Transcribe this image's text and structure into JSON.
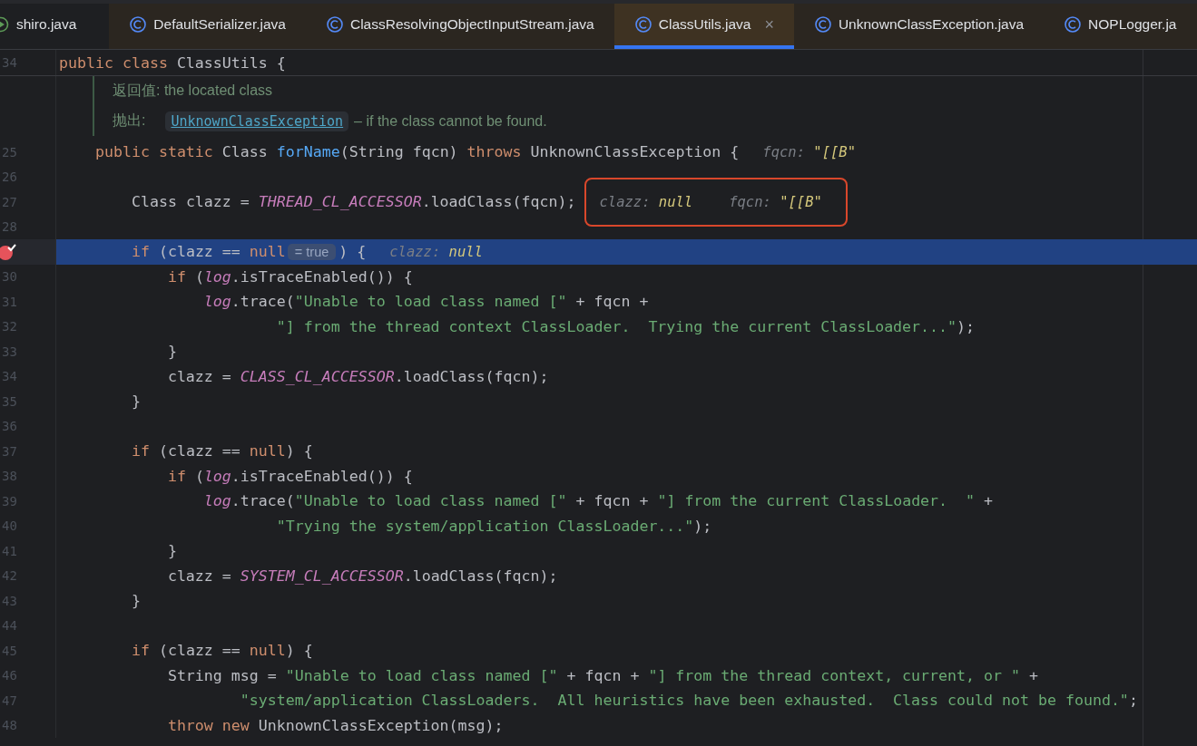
{
  "tabs": [
    {
      "label": "shiro.java",
      "selected": false
    },
    {
      "label": "DefaultSerializer.java",
      "selected": false
    },
    {
      "label": "ClassResolvingObjectInputStream.java",
      "selected": false
    },
    {
      "label": "ClassUtils.java",
      "selected": true,
      "close": "×"
    },
    {
      "label": "UnknownClassException.java",
      "selected": false
    },
    {
      "label": "NOPLogger.ja",
      "selected": false
    }
  ],
  "sticky_line": {
    "number": "34",
    "tokens": [
      {
        "kind": "keyword",
        "text": "public class "
      },
      {
        "kind": "plain",
        "text": "ClassUtils {"
      }
    ]
  },
  "doc": {
    "returns": "返回值: the located class",
    "throws_label": "抛出:",
    "throws_link": "UnknownClassException",
    "throws_text": "– if the class cannot be found."
  },
  "lines": [
    {
      "number": "25",
      "highlighted": false,
      "breakpoint": false,
      "tokens": [
        {
          "kind": "keyword",
          "text": "    public static "
        },
        {
          "kind": "plain",
          "text": "Class "
        },
        {
          "kind": "method",
          "text": "forName"
        },
        {
          "kind": "plain",
          "text": "(String fqcn) "
        },
        {
          "kind": "keyword",
          "text": "throws "
        },
        {
          "kind": "plain",
          "text": "UnknownClassException {"
        }
      ],
      "hints": [
        {
          "label": "fqcn:",
          "value": "\"[[B\""
        }
      ],
      "hints_framed": false
    },
    {
      "number": "26",
      "highlighted": false,
      "breakpoint": false
    },
    {
      "number": "27",
      "highlighted": false,
      "breakpoint": false,
      "tokens": [
        {
          "kind": "plain",
          "text": "        Class clazz = "
        },
        {
          "kind": "constant",
          "text": "THREAD_CL_ACCESSOR"
        },
        {
          "kind": "plain",
          "text": ".loadClass(fqcn);"
        }
      ],
      "hints": [
        {
          "label": "clazz:",
          "value": "null"
        },
        {
          "label": "fqcn:",
          "value": "\"[[B\""
        }
      ],
      "hints_framed": true
    },
    {
      "number": "28",
      "highlighted": false,
      "breakpoint": false
    },
    {
      "highlighted": true,
      "breakpoint": true,
      "tokens": [
        {
          "kind": "keyword",
          "text": "        if "
        },
        {
          "kind": "plain",
          "text": "(clazz == "
        },
        {
          "kind": "keyword",
          "text": "null"
        },
        {
          "kind": "eval",
          "text": "= true"
        },
        {
          "kind": "plain",
          "text": ") {"
        }
      ],
      "hints": [
        {
          "label": "clazz:",
          "value": "null"
        }
      ],
      "hints_framed": false
    },
    {
      "number": "30",
      "highlighted": false,
      "breakpoint": false,
      "tokens": [
        {
          "kind": "keyword",
          "text": "            if "
        },
        {
          "kind": "plain",
          "text": "("
        },
        {
          "kind": "field",
          "text": "log"
        },
        {
          "kind": "plain",
          "text": ".isTraceEnabled()) {"
        }
      ]
    },
    {
      "number": "31",
      "highlighted": false,
      "breakpoint": false,
      "tokens": [
        {
          "kind": "field",
          "text": "                log"
        },
        {
          "kind": "plain",
          "text": ".trace("
        },
        {
          "kind": "string",
          "text": "\"Unable to load class named [\""
        },
        {
          "kind": "plain",
          "text": " + fqcn +"
        }
      ]
    },
    {
      "number": "32",
      "highlighted": false,
      "breakpoint": false,
      "tokens": [
        {
          "kind": "string",
          "text": "                        \"] from the thread context ClassLoader.  Trying the current ClassLoader...\""
        },
        {
          "kind": "plain",
          "text": ");"
        }
      ]
    },
    {
      "number": "33",
      "highlighted": false,
      "breakpoint": false,
      "tokens": [
        {
          "kind": "plain",
          "text": "            }"
        }
      ]
    },
    {
      "number": "34",
      "highlighted": false,
      "breakpoint": false,
      "tokens": [
        {
          "kind": "plain",
          "text": "            clazz = "
        },
        {
          "kind": "constant",
          "text": "CLASS_CL_ACCESSOR"
        },
        {
          "kind": "plain",
          "text": ".loadClass(fqcn);"
        }
      ]
    },
    {
      "number": "35",
      "highlighted": false,
      "breakpoint": false,
      "tokens": [
        {
          "kind": "plain",
          "text": "        }"
        }
      ]
    },
    {
      "number": "36",
      "highlighted": false,
      "breakpoint": false
    },
    {
      "number": "37",
      "highlighted": false,
      "breakpoint": false,
      "tokens": [
        {
          "kind": "keyword",
          "text": "        if "
        },
        {
          "kind": "plain",
          "text": "(clazz == "
        },
        {
          "kind": "keyword",
          "text": "null"
        },
        {
          "kind": "plain",
          "text": ") {"
        }
      ]
    },
    {
      "number": "38",
      "highlighted": false,
      "breakpoint": false,
      "tokens": [
        {
          "kind": "keyword",
          "text": "            if "
        },
        {
          "kind": "plain",
          "text": "("
        },
        {
          "kind": "field",
          "text": "log"
        },
        {
          "kind": "plain",
          "text": ".isTraceEnabled()) {"
        }
      ]
    },
    {
      "number": "39",
      "highlighted": false,
      "breakpoint": false,
      "tokens": [
        {
          "kind": "field",
          "text": "                log"
        },
        {
          "kind": "plain",
          "text": ".trace("
        },
        {
          "kind": "string",
          "text": "\"Unable to load class named [\""
        },
        {
          "kind": "plain",
          "text": " + fqcn + "
        },
        {
          "kind": "string",
          "text": "\"] from the current ClassLoader.  \""
        },
        {
          "kind": "plain",
          "text": " +"
        }
      ]
    },
    {
      "number": "40",
      "highlighted": false,
      "breakpoint": false,
      "tokens": [
        {
          "kind": "string",
          "text": "                        \"Trying the system/application ClassLoader...\""
        },
        {
          "kind": "plain",
          "text": ");"
        }
      ]
    },
    {
      "number": "41",
      "highlighted": false,
      "breakpoint": false,
      "tokens": [
        {
          "kind": "plain",
          "text": "            }"
        }
      ]
    },
    {
      "number": "42",
      "highlighted": false,
      "breakpoint": false,
      "tokens": [
        {
          "kind": "plain",
          "text": "            clazz = "
        },
        {
          "kind": "constant",
          "text": "SYSTEM_CL_ACCESSOR"
        },
        {
          "kind": "plain",
          "text": ".loadClass(fqcn);"
        }
      ]
    },
    {
      "number": "43",
      "highlighted": false,
      "breakpoint": false,
      "tokens": [
        {
          "kind": "plain",
          "text": "        }"
        }
      ]
    },
    {
      "number": "44",
      "highlighted": false,
      "breakpoint": false
    },
    {
      "number": "45",
      "highlighted": false,
      "breakpoint": false,
      "tokens": [
        {
          "kind": "keyword",
          "text": "        if "
        },
        {
          "kind": "plain",
          "text": "(clazz == "
        },
        {
          "kind": "keyword",
          "text": "null"
        },
        {
          "kind": "plain",
          "text": ") {"
        }
      ]
    },
    {
      "number": "46",
      "highlighted": false,
      "breakpoint": false,
      "tokens": [
        {
          "kind": "plain",
          "text": "            String msg = "
        },
        {
          "kind": "string",
          "text": "\"Unable to load class named [\""
        },
        {
          "kind": "plain",
          "text": " + fqcn + "
        },
        {
          "kind": "string",
          "text": "\"] from the thread context, current, or \""
        },
        {
          "kind": "plain",
          "text": " +"
        }
      ]
    },
    {
      "number": "47",
      "highlighted": false,
      "breakpoint": false,
      "tokens": [
        {
          "kind": "string",
          "text": "                    \"system/application ClassLoaders.  All heuristics have been exhausted.  Class could not be found.\""
        },
        {
          "kind": "plain",
          "text": ";"
        }
      ]
    },
    {
      "number": "48",
      "highlighted": false,
      "breakpoint": false,
      "tokens": [
        {
          "kind": "keyword",
          "text": "            throw new "
        },
        {
          "kind": "plain",
          "text": "UnknownClassException(msg);"
        }
      ]
    }
  ]
}
